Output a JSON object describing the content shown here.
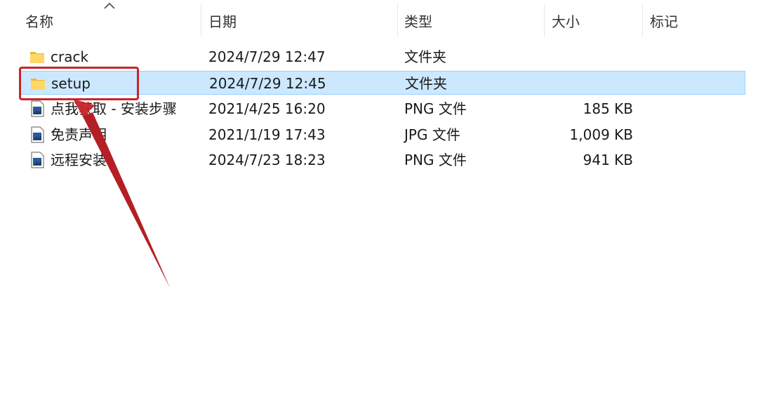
{
  "header": {
    "name_label": "名称",
    "date_label": "日期",
    "type_label": "类型",
    "size_label": "大小",
    "tags_label": "标记"
  },
  "files": [
    {
      "name": "crack",
      "date": "2024/7/29 12:47",
      "type": "文件夹",
      "size": "",
      "icon": "folder-icon",
      "selected": false
    },
    {
      "name": "setup",
      "date": "2024/7/29 12:45",
      "type": "文件夹",
      "size": "",
      "icon": "folder-icon",
      "selected": true
    },
    {
      "name": "点我获取 - 安装步骤",
      "date": "2021/4/25 16:20",
      "type": "PNG 文件",
      "size": "185 KB",
      "icon": "image-file-icon",
      "selected": false
    },
    {
      "name": "免责声明",
      "date": "2021/1/19 17:43",
      "type": "JPG 文件",
      "size": "1,009 KB",
      "icon": "image-file-icon",
      "selected": false
    },
    {
      "name": "远程安装",
      "date": "2024/7/23 18:23",
      "type": "PNG 文件",
      "size": "941 KB",
      "icon": "image-file-icon",
      "selected": false
    }
  ],
  "colors": {
    "selection_bg": "#cce8ff",
    "selection_border": "#99d1ff",
    "annotation_red": "#c8252a",
    "folder_yellow": "#ffd766"
  }
}
